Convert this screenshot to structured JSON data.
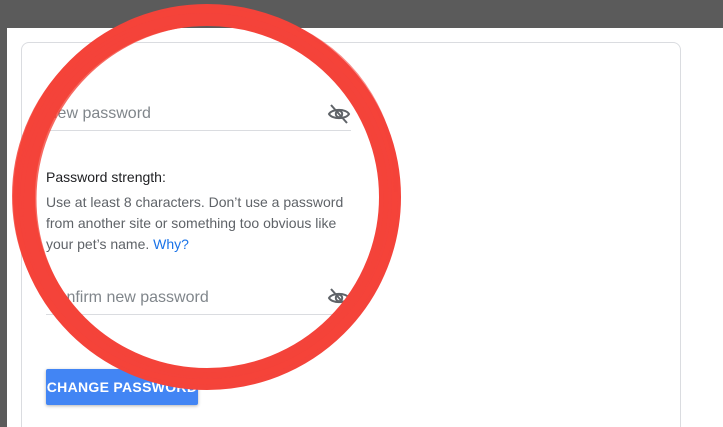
{
  "form": {
    "new_password": {
      "placeholder": "New password",
      "value": "",
      "visibility_icon": "eye-off-icon"
    },
    "strength": {
      "title": "Password strength:",
      "hint": "Use at least 8 characters. Don’t use a password from another site or something too obvious like your pet’s name. ",
      "link_label": "Why?"
    },
    "confirm_password": {
      "placeholder": "Confirm new password",
      "value": "",
      "visibility_icon": "eye-off-icon"
    },
    "submit_label": "CHANGE PASSWORD"
  },
  "colors": {
    "accent": "#4285f4",
    "link": "#1a73e8",
    "annotation": "#f4433a"
  }
}
